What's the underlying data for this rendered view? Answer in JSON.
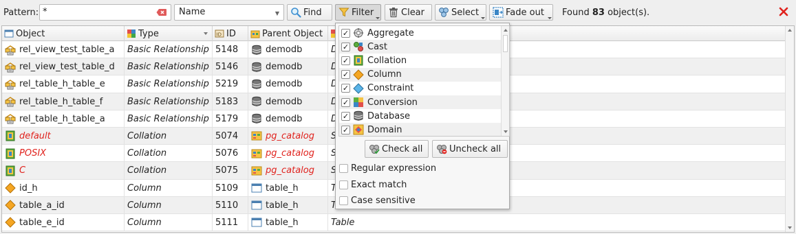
{
  "toolbar": {
    "pattern_label": "Pattern:",
    "pattern_value": "*",
    "field_select_value": "Name",
    "find_label": "Find",
    "filter_label": "Filter",
    "clear_label": "Clear",
    "select_label": "Select",
    "fade_out_label": "Fade out",
    "found_prefix": "Found",
    "found_count": "83",
    "found_suffix": "object(s).",
    "close_icon": "close-x-icon"
  },
  "table": {
    "columns": [
      {
        "label": "Object",
        "icon": "object-column-icon"
      },
      {
        "label": "Type",
        "icon": "type-column-icon"
      },
      {
        "label": "ID",
        "icon": "id-column-icon"
      },
      {
        "label": "Parent Object",
        "icon": "parent-object-column-icon"
      }
    ],
    "rows": [
      {
        "object": "rel_view_test_table_a",
        "icon": "relationship-icon",
        "type": "Basic Relationship",
        "id": "5148",
        "parent": "demodb",
        "parent_icon": "database-icon",
        "parent_type": "D",
        "red": false
      },
      {
        "object": "rel_view_test_table_d",
        "icon": "relationship-icon",
        "type": "Basic Relationship",
        "id": "5146",
        "parent": "demodb",
        "parent_icon": "database-icon",
        "parent_type": "D",
        "red": false
      },
      {
        "object": "rel_table_h_table_e",
        "icon": "relationship-icon",
        "type": "Basic Relationship",
        "id": "5219",
        "parent": "demodb",
        "parent_icon": "database-icon",
        "parent_type": "D",
        "red": false
      },
      {
        "object": "rel_table_h_table_f",
        "icon": "relationship-icon",
        "type": "Basic Relationship",
        "id": "5183",
        "parent": "demodb",
        "parent_icon": "database-icon",
        "parent_type": "D",
        "red": false
      },
      {
        "object": "rel_table_h_table_a",
        "icon": "relationship-icon",
        "type": "Basic Relationship",
        "id": "5179",
        "parent": "demodb",
        "parent_icon": "database-icon",
        "parent_type": "D",
        "red": false
      },
      {
        "object": "default",
        "icon": "collation-icon",
        "type": "Collation",
        "id": "5074",
        "parent": "pg_catalog",
        "parent_icon": "schema-icon",
        "parent_type": "S",
        "red": true
      },
      {
        "object": "POSIX",
        "icon": "collation-icon",
        "type": "Collation",
        "id": "5076",
        "parent": "pg_catalog",
        "parent_icon": "schema-icon",
        "parent_type": "S",
        "red": true
      },
      {
        "object": "C",
        "icon": "collation-icon",
        "type": "Collation",
        "id": "5075",
        "parent": "pg_catalog",
        "parent_icon": "schema-icon",
        "parent_type": "S",
        "red": true
      },
      {
        "object": "id_h",
        "icon": "column-icon",
        "type": "Column",
        "id": "5109",
        "parent": "table_h",
        "parent_icon": "table-icon",
        "parent_type": "T",
        "red": false
      },
      {
        "object": "table_a_id",
        "icon": "column-icon",
        "type": "Column",
        "id": "5110",
        "parent": "table_h",
        "parent_icon": "table-icon",
        "parent_type": "T",
        "red": false
      },
      {
        "object": "table_e_id",
        "icon": "column-icon",
        "type": "Column",
        "id": "5111",
        "parent": "table_h",
        "parent_icon": "table-icon",
        "parent_type": "Table",
        "red": false
      }
    ]
  },
  "filter_popup": {
    "items": [
      {
        "label": "Aggregate",
        "icon": "aggregate-icon",
        "checked": true
      },
      {
        "label": "Cast",
        "icon": "cast-icon",
        "checked": true
      },
      {
        "label": "Collation",
        "icon": "collation-icon",
        "checked": true
      },
      {
        "label": "Column",
        "icon": "column-icon",
        "checked": true
      },
      {
        "label": "Constraint",
        "icon": "constraint-icon",
        "checked": true
      },
      {
        "label": "Conversion",
        "icon": "conversion-icon",
        "checked": true
      },
      {
        "label": "Database",
        "icon": "database-icon",
        "checked": true
      },
      {
        "label": "Domain",
        "icon": "domain-icon",
        "checked": true
      }
    ],
    "check_all_label": "Check all",
    "uncheck_all_label": "Uncheck all",
    "options": [
      {
        "label": "Regular expression",
        "checked": false
      },
      {
        "label": "Exact match",
        "checked": false
      },
      {
        "label": "Case sensitive",
        "checked": false
      }
    ]
  },
  "colors": {
    "accent_red": "#e0221d",
    "alt_row": "#f0f0f0",
    "column_orange": "#f5a623",
    "constraint_blue": "#5ab4e8"
  }
}
